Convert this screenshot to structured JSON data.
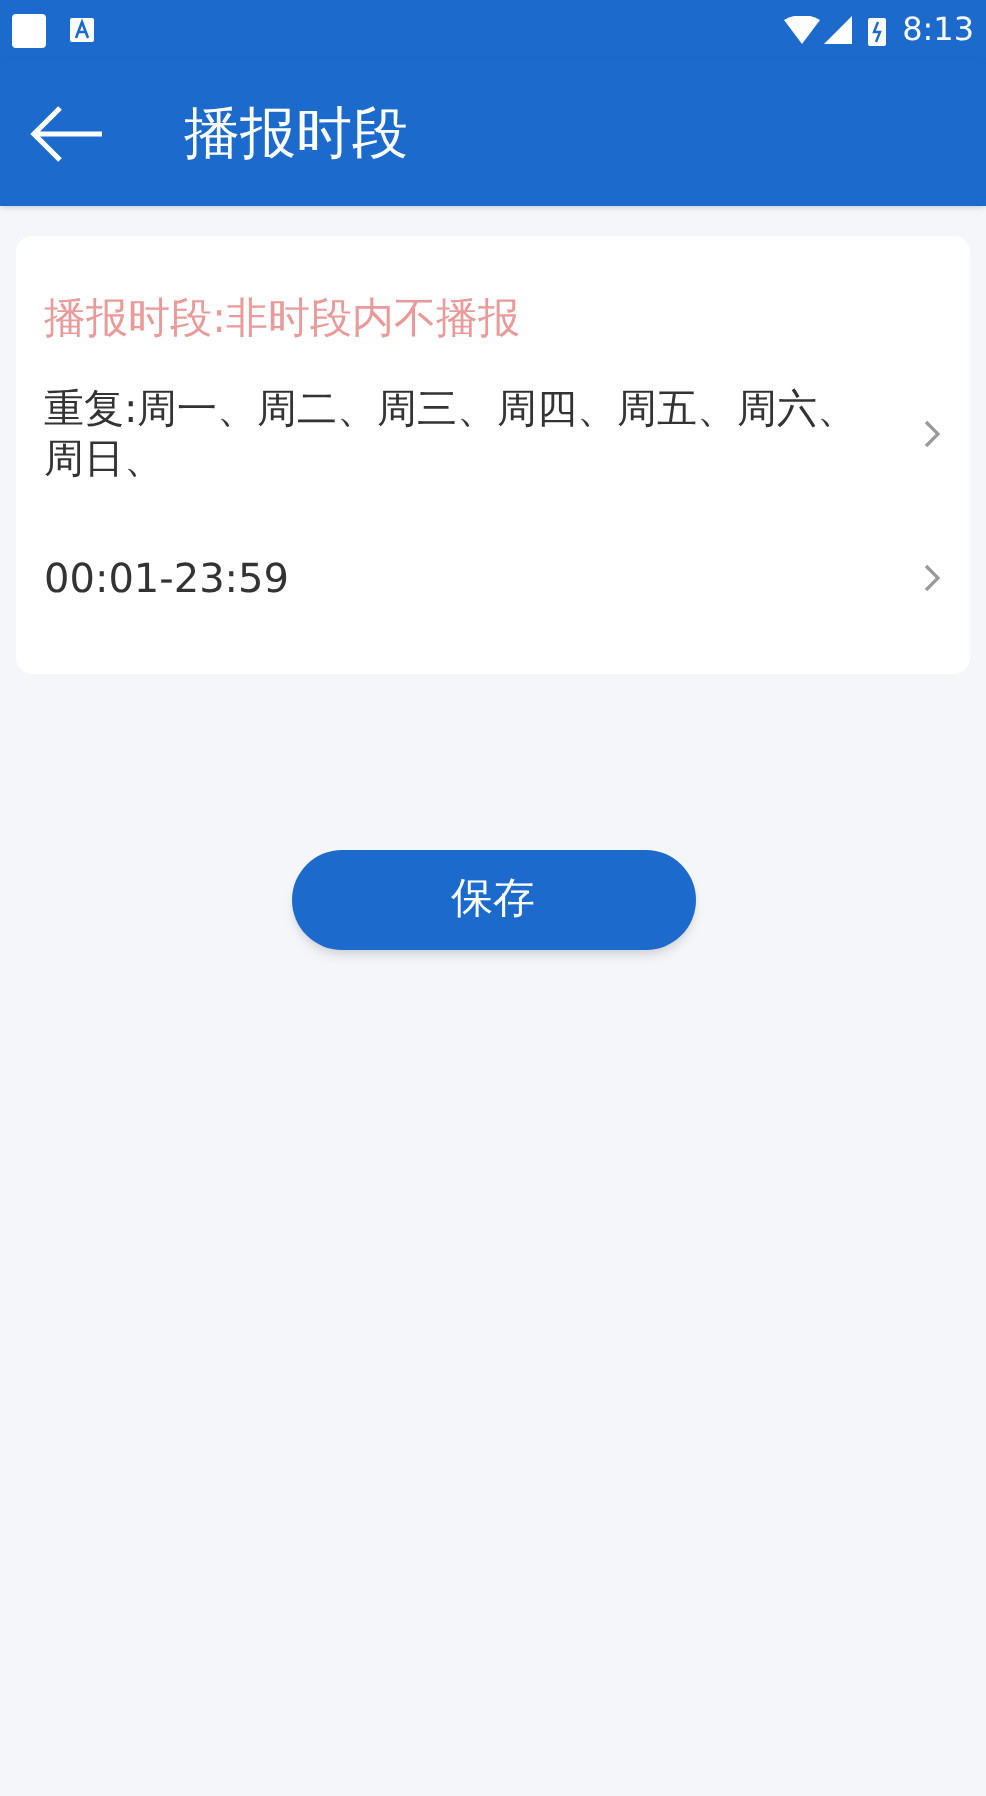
{
  "status_bar": {
    "time": "8:13"
  },
  "app_bar": {
    "title": "播报时段"
  },
  "card": {
    "notice": "播报时段:非时段内不播报",
    "rows": [
      {
        "text": "重复:周一、周二、周三、周四、周五、周六、周日、"
      },
      {
        "text": "00:01-23:59"
      }
    ]
  },
  "save_button": "保存"
}
